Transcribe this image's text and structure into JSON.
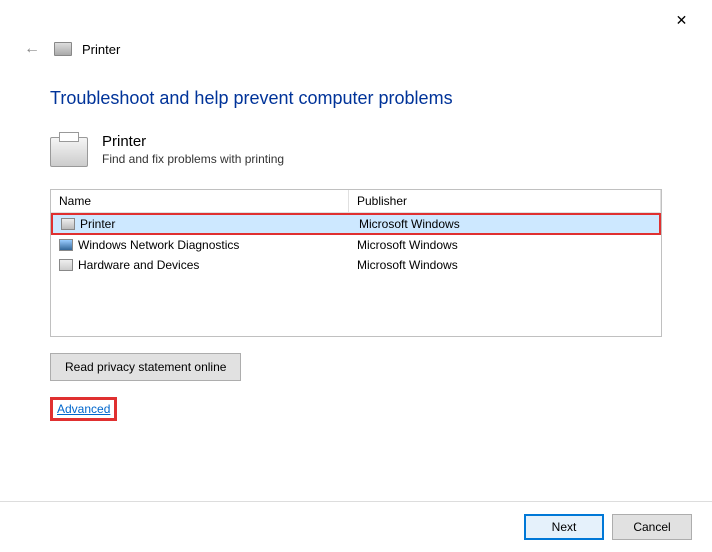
{
  "window": {
    "title": "Printer"
  },
  "main": {
    "heading": "Troubleshoot and help prevent computer problems",
    "section_title": "Printer",
    "section_desc": "Find and fix problems with printing"
  },
  "table": {
    "headers": {
      "name": "Name",
      "publisher": "Publisher"
    },
    "rows": [
      {
        "name": "Printer",
        "publisher": "Microsoft Windows",
        "icon": "printer",
        "selected": true
      },
      {
        "name": "Windows Network Diagnostics",
        "publisher": "Microsoft Windows",
        "icon": "net",
        "selected": false
      },
      {
        "name": "Hardware and Devices",
        "publisher": "Microsoft Windows",
        "icon": "hw",
        "selected": false
      }
    ]
  },
  "buttons": {
    "privacy": "Read privacy statement online",
    "advanced": "Advanced",
    "next": "Next",
    "cancel": "Cancel"
  }
}
